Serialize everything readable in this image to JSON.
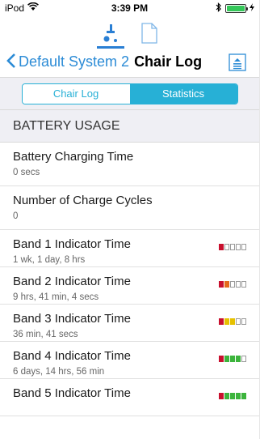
{
  "status_bar": {
    "carrier": "iPod",
    "time": "3:39 PM"
  },
  "nav": {
    "back_label": "Default System 2",
    "title": "Chair Log"
  },
  "segments": [
    {
      "label": "Chair Log",
      "selected": false
    },
    {
      "label": "Statistics",
      "selected": true
    }
  ],
  "section_header": "BATTERY USAGE",
  "rows": [
    {
      "title": "Battery Charging Time",
      "value": "0 secs"
    },
    {
      "title": "Number of Charge Cycles",
      "value": "0"
    }
  ],
  "bands": [
    {
      "title": "Band 1 Indicator Time",
      "value": "1 wk, 1 day, 8 hrs",
      "level": 1
    },
    {
      "title": "Band 2 Indicator Time",
      "value": "9 hrs, 41 min, 4 secs",
      "level": 2
    },
    {
      "title": "Band 3 Indicator Time",
      "value": "36 min, 41 secs",
      "level": 3
    },
    {
      "title": "Band 4 Indicator Time",
      "value": "6 days, 14 hrs, 56 min",
      "level": 4
    },
    {
      "title": "Band 5 Indicator Time",
      "value": "",
      "level": 5
    }
  ],
  "colors": {
    "accent": "#2b8bd6",
    "segment": "#27b0d6",
    "band_red": "#c8102e",
    "band_orange": "#e46a1b",
    "band_yellow": "#e6c100",
    "band_green": "#3cb43c"
  },
  "icons": {
    "wifi": "wifi-icon",
    "bluetooth": "bluetooth-icon",
    "battery": "battery-icon",
    "chair_tab": "wheelchair-icon",
    "document_tab": "document-icon",
    "share": "share-icon"
  }
}
